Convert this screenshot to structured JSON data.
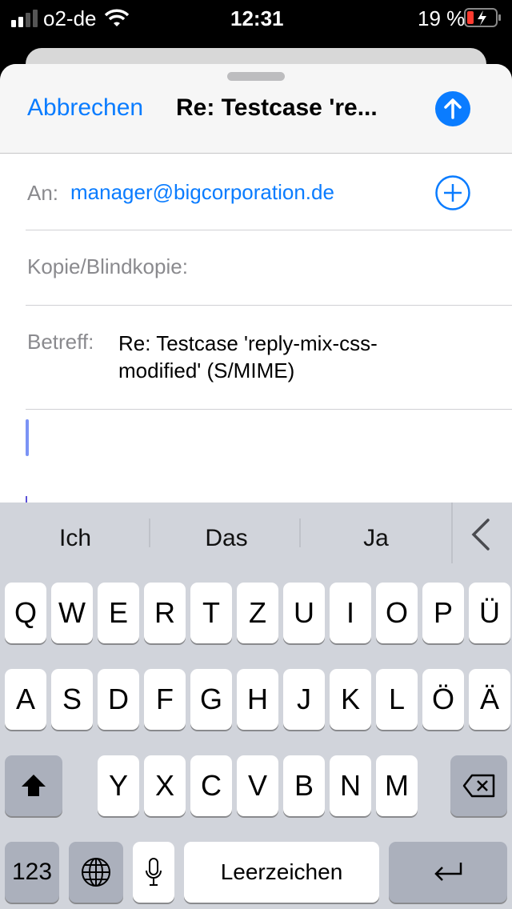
{
  "status_bar": {
    "carrier": "o2-de",
    "time": "12:31",
    "battery": "19 %",
    "battery_level_percent": 19,
    "charging": true
  },
  "nav": {
    "cancel_label": "Abbrechen",
    "title": "Re: Testcase 're...",
    "send_icon": "arrow-up-circle-icon"
  },
  "fields": {
    "to_label": "An:",
    "to_value": "manager@bigcorporation.de",
    "cc_label": "Kopie/Blindkopie:",
    "subject_label": "Betreff:",
    "subject_value": "Re: Testcase 'reply-mix-css-modified' (S/MIME)"
  },
  "suggestions": [
    "Ich",
    "Das",
    "Ja"
  ],
  "keyboard": {
    "row1": [
      "Q",
      "W",
      "E",
      "R",
      "T",
      "Z",
      "U",
      "I",
      "O",
      "P",
      "Ü"
    ],
    "row2": [
      "A",
      "S",
      "D",
      "F",
      "G",
      "H",
      "J",
      "K",
      "L",
      "Ö",
      "Ä"
    ],
    "row3": [
      "Y",
      "X",
      "C",
      "V",
      "B",
      "N",
      "M"
    ],
    "numbers_label": "123",
    "space_label": "Leerzeichen"
  },
  "colors": {
    "accent": "#0a7cff",
    "keyboard_bg": "#d1d4db"
  }
}
